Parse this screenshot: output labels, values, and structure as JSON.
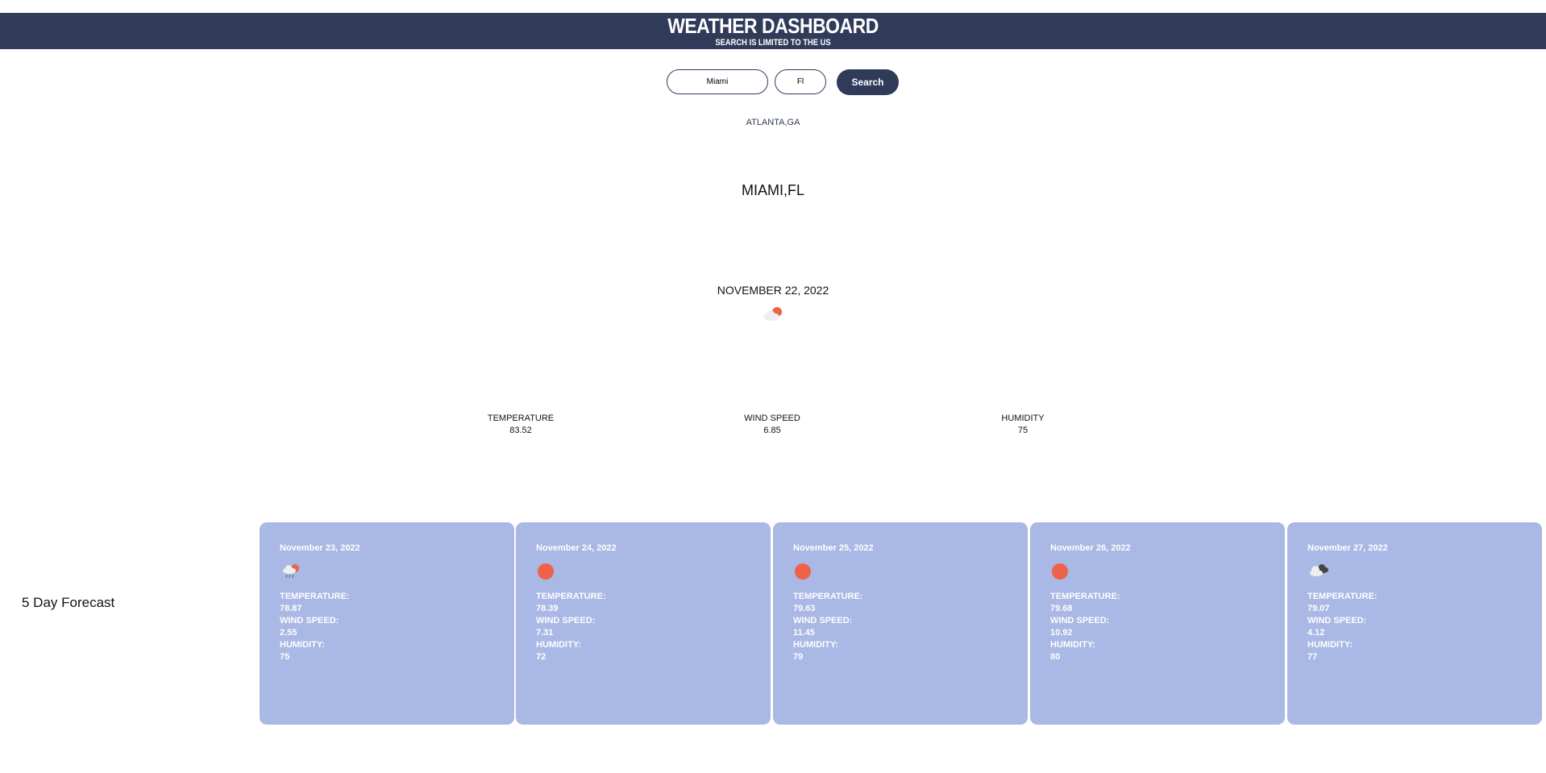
{
  "header": {
    "title": "WEATHER DASHBOARD",
    "subtitle": "SEARCH IS LIMITED TO THE US",
    "background_color": "#303b5a"
  },
  "search": {
    "city_value": "Miami",
    "state_value": "Fl",
    "button_label": "Search"
  },
  "history": [
    {
      "label": "ATLANTA,GA"
    }
  ],
  "current": {
    "city": "MIAMI,FL",
    "date": "NOVEMBER 22, 2022",
    "icon": "partly-cloudy-icon",
    "temperature_label": "TEMPERATURE",
    "temperature": "83.52",
    "wind_label": "WIND SPEED",
    "wind": "6.85",
    "humidity_label": "HUMIDITY",
    "humidity": "75"
  },
  "forecast": {
    "heading": "5 Day Forecast",
    "card_color": "#a9b8e4",
    "temp_label": "TEMPERATURE:",
    "wind_label": "WIND SPEED:",
    "humidity_label": "HUMIDITY:",
    "days": [
      {
        "date": "November 23, 2022",
        "icon": "rain-cloud-icon",
        "temperature": "78.87",
        "wind": "2.55",
        "humidity": "75"
      },
      {
        "date": "November 24, 2022",
        "icon": "sun-icon",
        "temperature": "78.39",
        "wind": "7.31",
        "humidity": "72"
      },
      {
        "date": "November 25, 2022",
        "icon": "sun-icon",
        "temperature": "79.63",
        "wind": "11.45",
        "humidity": "79"
      },
      {
        "date": "November 26, 2022",
        "icon": "sun-icon",
        "temperature": "79.68",
        "wind": "10.92",
        "humidity": "80"
      },
      {
        "date": "November 27, 2022",
        "icon": "cloudy-icon",
        "temperature": "79.07",
        "wind": "4.12",
        "humidity": "77"
      }
    ]
  }
}
